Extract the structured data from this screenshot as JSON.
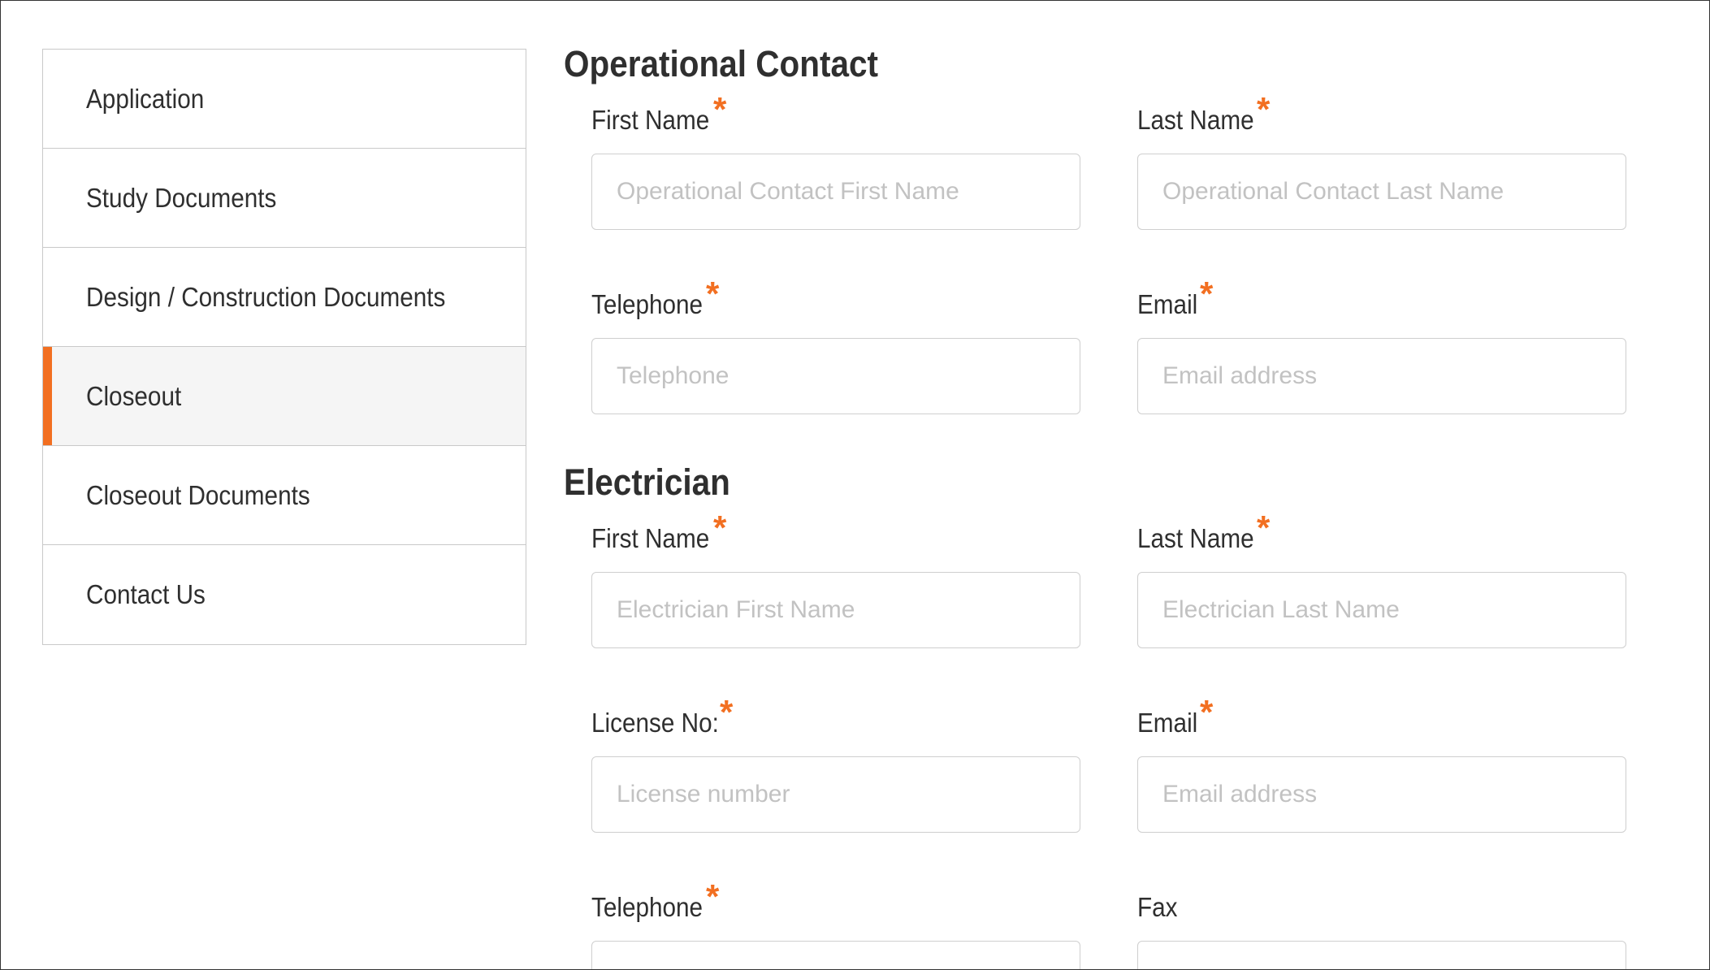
{
  "sidebar": {
    "items": [
      {
        "label": "Application",
        "active": false
      },
      {
        "label": "Study Documents",
        "active": false
      },
      {
        "label": "Design / Construction Documents",
        "active": false
      },
      {
        "label": "Closeout",
        "active": true
      },
      {
        "label": "Closeout Documents",
        "active": false
      },
      {
        "label": "Contact Us",
        "active": false
      }
    ]
  },
  "operational_contact": {
    "title": "Operational Contact",
    "first_name": {
      "label": "First Name",
      "required": true,
      "placeholder": "Operational Contact First Name",
      "value": ""
    },
    "last_name": {
      "label": "Last Name",
      "required": true,
      "placeholder": "Operational Contact Last Name",
      "value": ""
    },
    "telephone": {
      "label": "Telephone",
      "required": true,
      "placeholder": "Telephone",
      "value": ""
    },
    "email": {
      "label": "Email",
      "required": true,
      "placeholder": "Email address",
      "value": ""
    }
  },
  "electrician": {
    "title": "Electrician",
    "first_name": {
      "label": "First Name",
      "required": true,
      "placeholder": "Electrician First Name",
      "value": ""
    },
    "last_name": {
      "label": "Last Name",
      "required": true,
      "placeholder": "Electrician Last Name",
      "value": ""
    },
    "license_no": {
      "label": "License No:",
      "required": true,
      "placeholder": "License number",
      "value": ""
    },
    "email": {
      "label": "Email",
      "required": true,
      "placeholder": "Email address",
      "value": ""
    },
    "telephone": {
      "label": "Telephone",
      "required": true,
      "placeholder": "",
      "value": ""
    },
    "fax": {
      "label": "Fax",
      "required": false,
      "placeholder": "",
      "value": ""
    }
  },
  "required_marker": "*",
  "colors": {
    "accent": "#f26f21",
    "border": "#cfcfcf",
    "text": "#2f2f2f",
    "placeholder": "#c2c2c2",
    "active_bg": "#f5f5f5"
  }
}
